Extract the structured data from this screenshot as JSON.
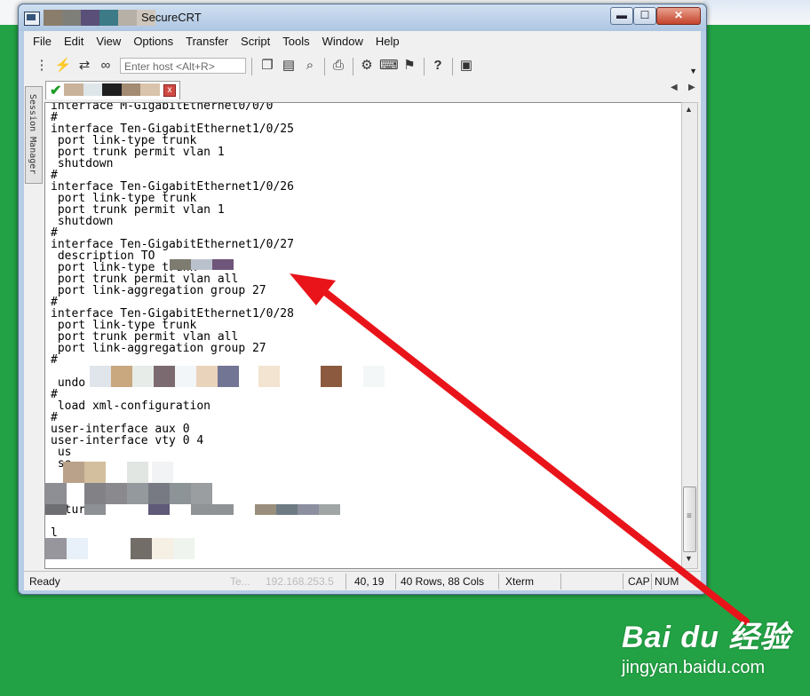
{
  "window": {
    "title": "SecureCRT",
    "buttons": {
      "minimize": "▬",
      "maximize": "☐",
      "close": "✕"
    }
  },
  "menu": [
    "File",
    "Edit",
    "View",
    "Options",
    "Transfer",
    "Script",
    "Tools",
    "Window",
    "Help"
  ],
  "toolbar": {
    "host_placeholder": "Enter host <Alt+R>",
    "icons": [
      "connect-icon",
      "quick-connect-icon",
      "reconnect-icon",
      "disconnect-icon",
      "copy-icon",
      "paste-icon",
      "find-icon",
      "print-icon",
      "settings-icon",
      "keymap-icon",
      "sftp-icon",
      "help-icon",
      "screen-icon"
    ]
  },
  "session_manager": {
    "label": "Session Manager"
  },
  "tab": {
    "close": "x"
  },
  "terminal": {
    "lines": [
      "interface M-GigabitEthernet0/0/0",
      "#",
      "interface Ten-GigabitEthernet1/0/25",
      " port link-type trunk",
      " port trunk permit vlan 1",
      " shutdown",
      "#",
      "interface Ten-GigabitEthernet1/0/26",
      " port link-type trunk",
      " port trunk permit vlan 1",
      " shutdown",
      "#",
      "interface Ten-GigabitEthernet1/0/27",
      " description TO",
      " port link-type trunk",
      " port trunk permit vlan all",
      " port link-aggregation group 27",
      "#",
      "interface Ten-GigabitEthernet1/0/28",
      " port link-type trunk",
      " port trunk permit vlan all",
      " port link-aggregation group 27",
      "#",
      "",
      " undo info-center enable",
      "#",
      " load xml-configuration",
      "#",
      "user-interface aux 0",
      "user-interface vty 0 4",
      " us",
      " se",
      "",
      "",
      "#",
      "return",
      "",
      "l"
    ]
  },
  "status": {
    "ready": "Ready",
    "session": "Te...",
    "ip": "192.168.253.5",
    "position": "40,  19",
    "size": "40 Rows, 88 Cols",
    "term": "Xterm",
    "cap": "CAP",
    "num": "NUM"
  },
  "watermark": {
    "logo": "Bai du 经验",
    "site": "jingyan.baidu.com"
  },
  "colors": {
    "desktop": "#22a244",
    "arrow": "#e8141a",
    "check": "#1f9e27"
  }
}
